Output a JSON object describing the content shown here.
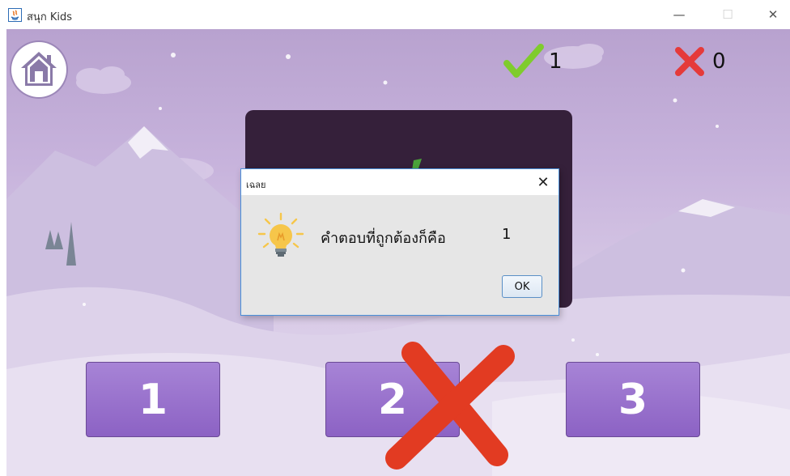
{
  "window": {
    "title": "สนุก Kids",
    "minimize_glyph": "—",
    "maximize_glyph": "☐",
    "close_glyph": "✕"
  },
  "game": {
    "home_icon": "home-icon",
    "score": {
      "correct_icon": "checkmark-icon",
      "correct_color": "#7fcc2d",
      "correct_count": "1",
      "wrong_icon": "x-mark-icon",
      "wrong_color": "#e53a3a",
      "wrong_count": "0"
    },
    "answers": [
      {
        "label": "1"
      },
      {
        "label": "2"
      },
      {
        "label": "3"
      }
    ],
    "answer_color": "#9a72cf",
    "wrong_mark_color": "#e23b22"
  },
  "dialog": {
    "title": "เฉลย",
    "close_glyph": "✕",
    "icon": "lightbulb-icon",
    "message": "คำตอบที่ถูกต้องก็คือ",
    "answer": "1",
    "ok_label": "OK"
  }
}
